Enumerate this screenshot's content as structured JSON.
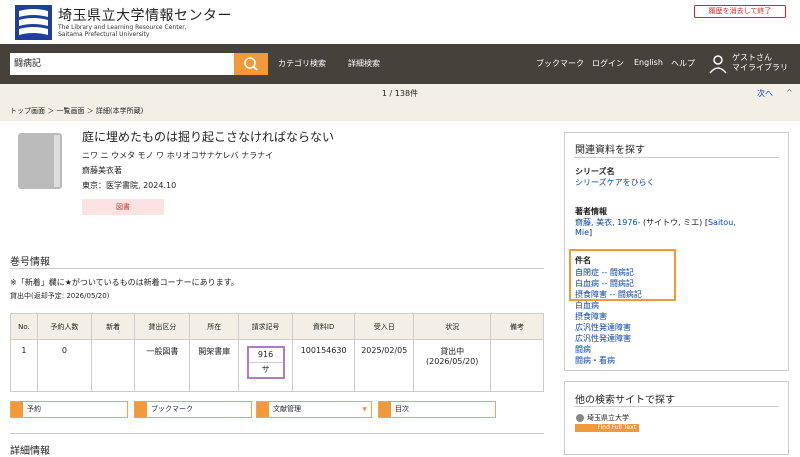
{
  "header": {
    "logo_title": "埼玉県立大学情報センター",
    "logo_sub1": "The Library and Learning  Resource Center,",
    "logo_sub2": "Saitama Prefectural University",
    "clear_history": "履歴を消去して終了"
  },
  "search": {
    "value": "闘病記"
  },
  "nav": {
    "category_search": "カテゴリ検索",
    "advanced_search": "詳細検索",
    "bookmark": "ブックマーク",
    "login": "ログイン",
    "english": "English",
    "help": "ヘルプ",
    "user_line1": "ゲストさん",
    "user_line2": "マイライブラリ"
  },
  "pager": {
    "count": "1 / 138件",
    "next": "次へ",
    "up": "^"
  },
  "breadcrumb": {
    "text": "トップ画面 ＞ 一覧画面 ＞ 詳細(本学所蔵)"
  },
  "book": {
    "title": "庭に埋めたものは掘り起こさなければならない",
    "reading": "ニワ ニ ウメタ モノ ワ ホリオコサナケレバ ナラナイ",
    "author": "齋藤美衣著",
    "publisher": "東京：医学書院, 2024.10",
    "material_type": "図書"
  },
  "holdings": {
    "heading": "巻号情報",
    "note": "※「新着」欄に★がついているものは新着コーナーにあります。",
    "loan_due": "貸出中(返却予定: 2026/05/20)",
    "columns": [
      "No.",
      "予約人数",
      "新着",
      "貸出区分",
      "所在",
      "請求記号",
      "資料ID",
      "受入日",
      "状況",
      "備考"
    ],
    "rows": [
      {
        "no": "1",
        "reserve": "0",
        "new": "",
        "loan_type": "一般図書",
        "location": "開架書庫",
        "call_top": "916",
        "call_bottom": "サ",
        "item_id": "100154630",
        "received": "2025/02/05",
        "status1": "貸出中",
        "status2": "(2026/05/20)",
        "remarks": ""
      }
    ]
  },
  "actions": {
    "reserve": "予約",
    "bookmark": "ブックマーク",
    "ref_manage": "文献管理",
    "toc": "目次"
  },
  "detail": {
    "heading": "詳細情報"
  },
  "sidebar": {
    "heading": "関連資料を探す",
    "series_label": "シリーズ名",
    "series_link": "シリーズケアをひらく",
    "author_label": "著者情報",
    "author_link": "齋藤, 美衣, 1976-",
    "author_text": " (サイトウ, ミエ) [",
    "author_link2a": "Saitou,",
    "author_link2b": "Mie",
    "author_close": "]",
    "subject_label": "件名",
    "subjects": [
      "自閉症 -- 闘病記",
      "白血病 -- 闘病記",
      "摂食障害 -- 闘病記",
      "白血病",
      "摂食障害",
      "広汎性発達障害",
      "広汎性発達障害",
      "闘病",
      "闘病・看病"
    ]
  },
  "other": {
    "heading": "他の検索サイトで探す",
    "logo_text": "埼玉県立大学",
    "logo_banner": "Find Full Text"
  },
  "colors": {
    "navbar": "#45413b",
    "accent": "#f29a3a",
    "link": "#0645ad",
    "clear": "#dd2222"
  }
}
